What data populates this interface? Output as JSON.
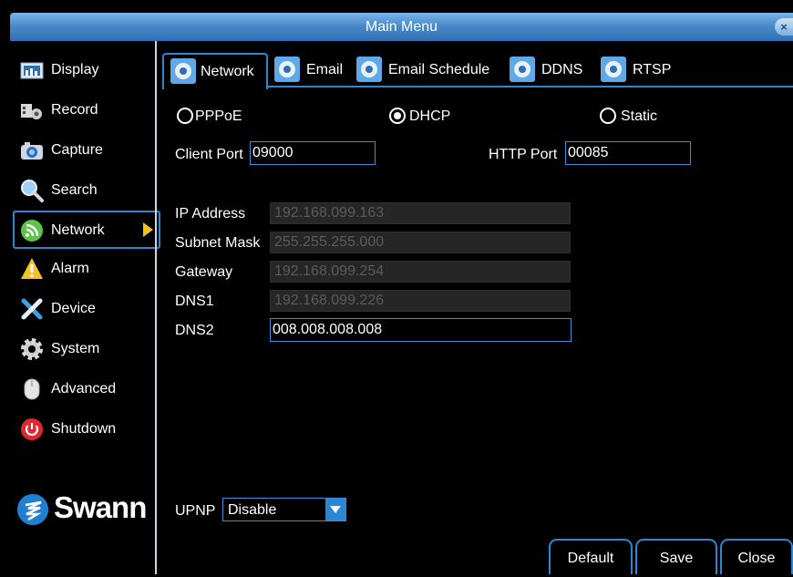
{
  "title": "Main Menu",
  "close_glyph": "×",
  "sidebar": {
    "items": [
      {
        "label": "Display",
        "icon": "display-icon"
      },
      {
        "label": "Record",
        "icon": "record-icon"
      },
      {
        "label": "Capture",
        "icon": "camera-icon"
      },
      {
        "label": "Search",
        "icon": "search-icon"
      },
      {
        "label": "Network",
        "icon": "network-icon",
        "selected": true
      },
      {
        "label": "Alarm",
        "icon": "alarm-icon"
      },
      {
        "label": "Device",
        "icon": "tools-icon"
      },
      {
        "label": "System",
        "icon": "gear-icon"
      },
      {
        "label": "Advanced",
        "icon": "mouse-icon"
      },
      {
        "label": "Shutdown",
        "icon": "power-icon"
      }
    ]
  },
  "logo_text": "Swann",
  "tabs": [
    {
      "label": "Network",
      "active": true
    },
    {
      "label": "Email"
    },
    {
      "label": "Email Schedule"
    },
    {
      "label": "DDNS"
    },
    {
      "label": "RTSP"
    }
  ],
  "connection": {
    "options": [
      "PPPoE",
      "DHCP",
      "Static"
    ],
    "selected": "DHCP"
  },
  "client_port": {
    "label": "Client Port",
    "value": "09000"
  },
  "http_port": {
    "label": "HTTP Port",
    "value": "00085"
  },
  "ip_address": {
    "label": "IP Address",
    "value": "192.168.099.163"
  },
  "subnet_mask": {
    "label": "Subnet Mask",
    "value": "255.255.255.000"
  },
  "gateway": {
    "label": "Gateway",
    "value": "192.168.099.254"
  },
  "dns1": {
    "label": "DNS1",
    "value": "192.168.099.226"
  },
  "dns2": {
    "label": "DNS2",
    "value": "008.008.008.008"
  },
  "upnp": {
    "label": "UPNP",
    "value": "Disable"
  },
  "buttons": {
    "default": "Default",
    "save": "Save",
    "close": "Close"
  },
  "colors": {
    "accent": "#2d86d4",
    "titlebar": "#4b8bca",
    "arrow": "#f3c21a"
  }
}
